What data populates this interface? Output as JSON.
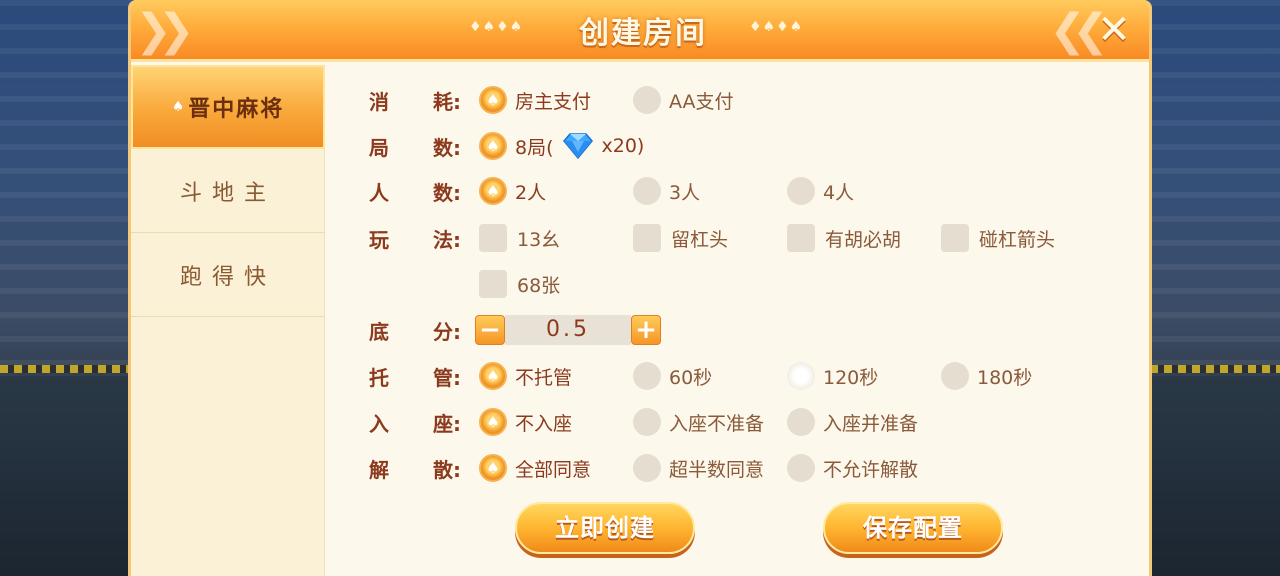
{
  "dialog": {
    "title": "创建房间",
    "title_deco_left": "♦♠♦♠",
    "title_deco_right": "♦♠♦♠"
  },
  "sidebar": {
    "items": [
      {
        "label": "晋中麻将",
        "active": true
      },
      {
        "label": "斗地主",
        "active": false
      },
      {
        "label": "跑得快",
        "active": false
      }
    ]
  },
  "settings": {
    "cost": {
      "label_a": "消",
      "label_b": "耗:",
      "options": [
        "房主支付",
        "AA支付"
      ],
      "selected": 0
    },
    "rounds": {
      "label_a": "局",
      "label_b": "数:",
      "option_prefix": "8局(",
      "option_suffix": "x20)",
      "gem_icon": "diamond-icon"
    },
    "players": {
      "label_a": "人",
      "label_b": "数:",
      "options": [
        "2人",
        "3人",
        "4人"
      ],
      "selected": 0
    },
    "rules": {
      "label_a": "玩",
      "label_b": "法:",
      "options": [
        "13幺",
        "留杠头",
        "有胡必胡",
        "碰杠箭头",
        "68张"
      ]
    },
    "base_score": {
      "label_a": "底",
      "label_b": "分:",
      "value": "0.5",
      "minus": "−",
      "plus": "+"
    },
    "auto_play": {
      "label_a": "托",
      "label_b": "管:",
      "options": [
        "不托管",
        "60秒",
        "120秒",
        "180秒"
      ],
      "selected": 0
    },
    "seating": {
      "label_a": "入",
      "label_b": "座:",
      "options": [
        "不入座",
        "入座不准备",
        "入座并准备"
      ],
      "selected": 0
    },
    "dissolve": {
      "label_a": "解",
      "label_b": "散:",
      "options": [
        "全部同意",
        "超半数同意",
        "不允许解散"
      ],
      "selected": 0
    }
  },
  "actions": {
    "create": "立即创建",
    "save": "保存配置"
  },
  "colors": {
    "accent": "#f59527",
    "label": "#8c3a1e",
    "panel_bg": "#fdf8ec"
  }
}
